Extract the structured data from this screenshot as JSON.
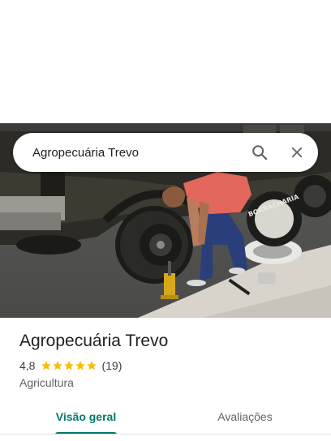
{
  "search": {
    "query": "Agropecuária Trevo"
  },
  "hero": {
    "tire_sign": "BORRACHARIA"
  },
  "place": {
    "name": "Agropecuária Trevo",
    "rating": "4,8",
    "stars": 5,
    "review_count": "(19)",
    "category": "Agricultura"
  },
  "tabs": [
    {
      "label": "Visão geral",
      "active": true
    },
    {
      "label": "Avaliações",
      "active": false
    }
  ],
  "colors": {
    "accent": "#00796b",
    "star": "#fbbc04",
    "text_primary": "#202124",
    "text_secondary": "#5f6368"
  }
}
